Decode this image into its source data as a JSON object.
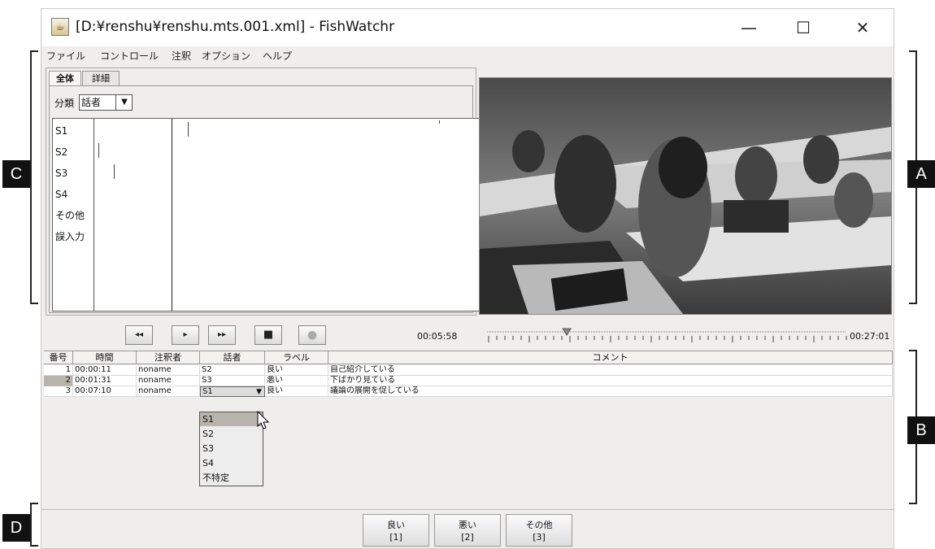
{
  "window": {
    "title": "[D:¥renshu¥renshu.mts.001.xml] - FishWatchr",
    "minimize": "—",
    "maximize": "☐",
    "close": "✕"
  },
  "menu": [
    "ファイル",
    "コントロール",
    "注釈",
    "オプション",
    "ヘルプ"
  ],
  "tabs": [
    "全体",
    "詳細"
  ],
  "classification": {
    "label": "分類",
    "value": "話者",
    "arrow": "▼"
  },
  "timeline": {
    "labels": [
      "S1",
      "S2",
      "S3",
      "S4",
      "その他",
      "誤入力"
    ]
  },
  "controls": {
    "rewind": "◂◂",
    "play": "▸",
    "forward": "▸▸",
    "stop": "■",
    "record": "●"
  },
  "playback": {
    "current_time": "00:05:58",
    "total_time": "00:27:01",
    "progress": 0.22
  },
  "table": {
    "columns": [
      "番号",
      "時間",
      "注釈者",
      "話者",
      "ラベル",
      "コメント"
    ],
    "rows": [
      {
        "num": "1",
        "time": "00:00:11",
        "annotator": "noname",
        "speaker": "S2",
        "label": "良い",
        "comment": "自己紹介している"
      },
      {
        "num": "2",
        "time": "00:01:31",
        "annotator": "noname",
        "speaker": "S3",
        "label": "悪い",
        "comment": "下ばかり見ている"
      },
      {
        "num": "3",
        "time": "00:07:10",
        "annotator": "noname",
        "speaker": "S1",
        "label": "良い",
        "comment": "議論の展開を促している"
      }
    ],
    "dropdown_arrow": "▼"
  },
  "dropdown": [
    "S1",
    "S2",
    "S3",
    "S4",
    "不特定"
  ],
  "buttons": [
    {
      "label": "良い",
      "key": "[1]"
    },
    {
      "label": "悪い",
      "key": "[2]"
    },
    {
      "label": "その他",
      "key": "[3]"
    }
  ],
  "annotations": [
    "A",
    "B",
    "C",
    "D"
  ]
}
